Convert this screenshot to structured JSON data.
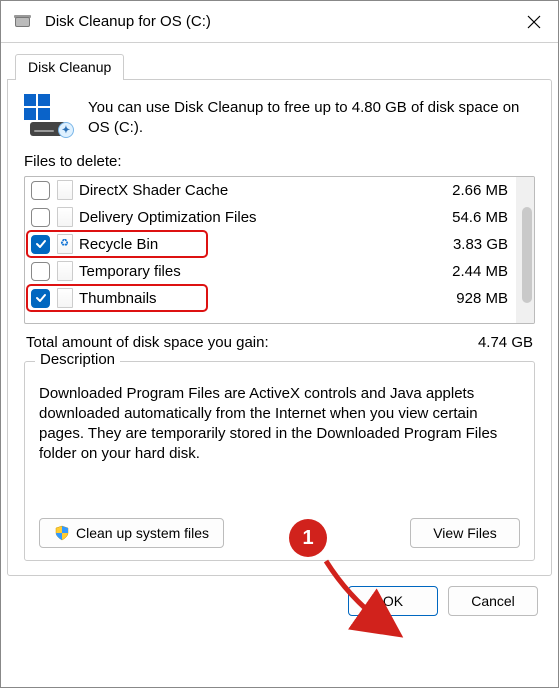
{
  "window": {
    "title": "Disk Cleanup for OS (C:)"
  },
  "tab": {
    "label": "Disk Cleanup"
  },
  "intro": "You can use Disk Cleanup to free up to 4.80 GB of disk space on OS (C:).",
  "sectionLabel": "Files to delete:",
  "files": [
    {
      "name": "DirectX Shader Cache",
      "size": "2.66 MB",
      "checked": false,
      "icon": "file"
    },
    {
      "name": "Delivery Optimization Files",
      "size": "54.6 MB",
      "checked": false,
      "icon": "file"
    },
    {
      "name": "Recycle Bin",
      "size": "3.83 GB",
      "checked": true,
      "icon": "recycle"
    },
    {
      "name": "Temporary files",
      "size": "2.44 MB",
      "checked": false,
      "icon": "file"
    },
    {
      "name": "Thumbnails",
      "size": "928 MB",
      "checked": true,
      "icon": "file"
    }
  ],
  "total": {
    "label": "Total amount of disk space you gain:",
    "value": "4.74 GB"
  },
  "description": {
    "title": "Description",
    "text": "Downloaded Program Files are ActiveX controls and Java applets downloaded automatically from the Internet when you view certain pages. They are temporarily stored in the Downloaded Program Files folder on your hard disk."
  },
  "buttons": {
    "cleanSystem": "Clean up system files",
    "viewFiles": "View Files",
    "ok": "OK",
    "cancel": "Cancel"
  },
  "callout": "1"
}
